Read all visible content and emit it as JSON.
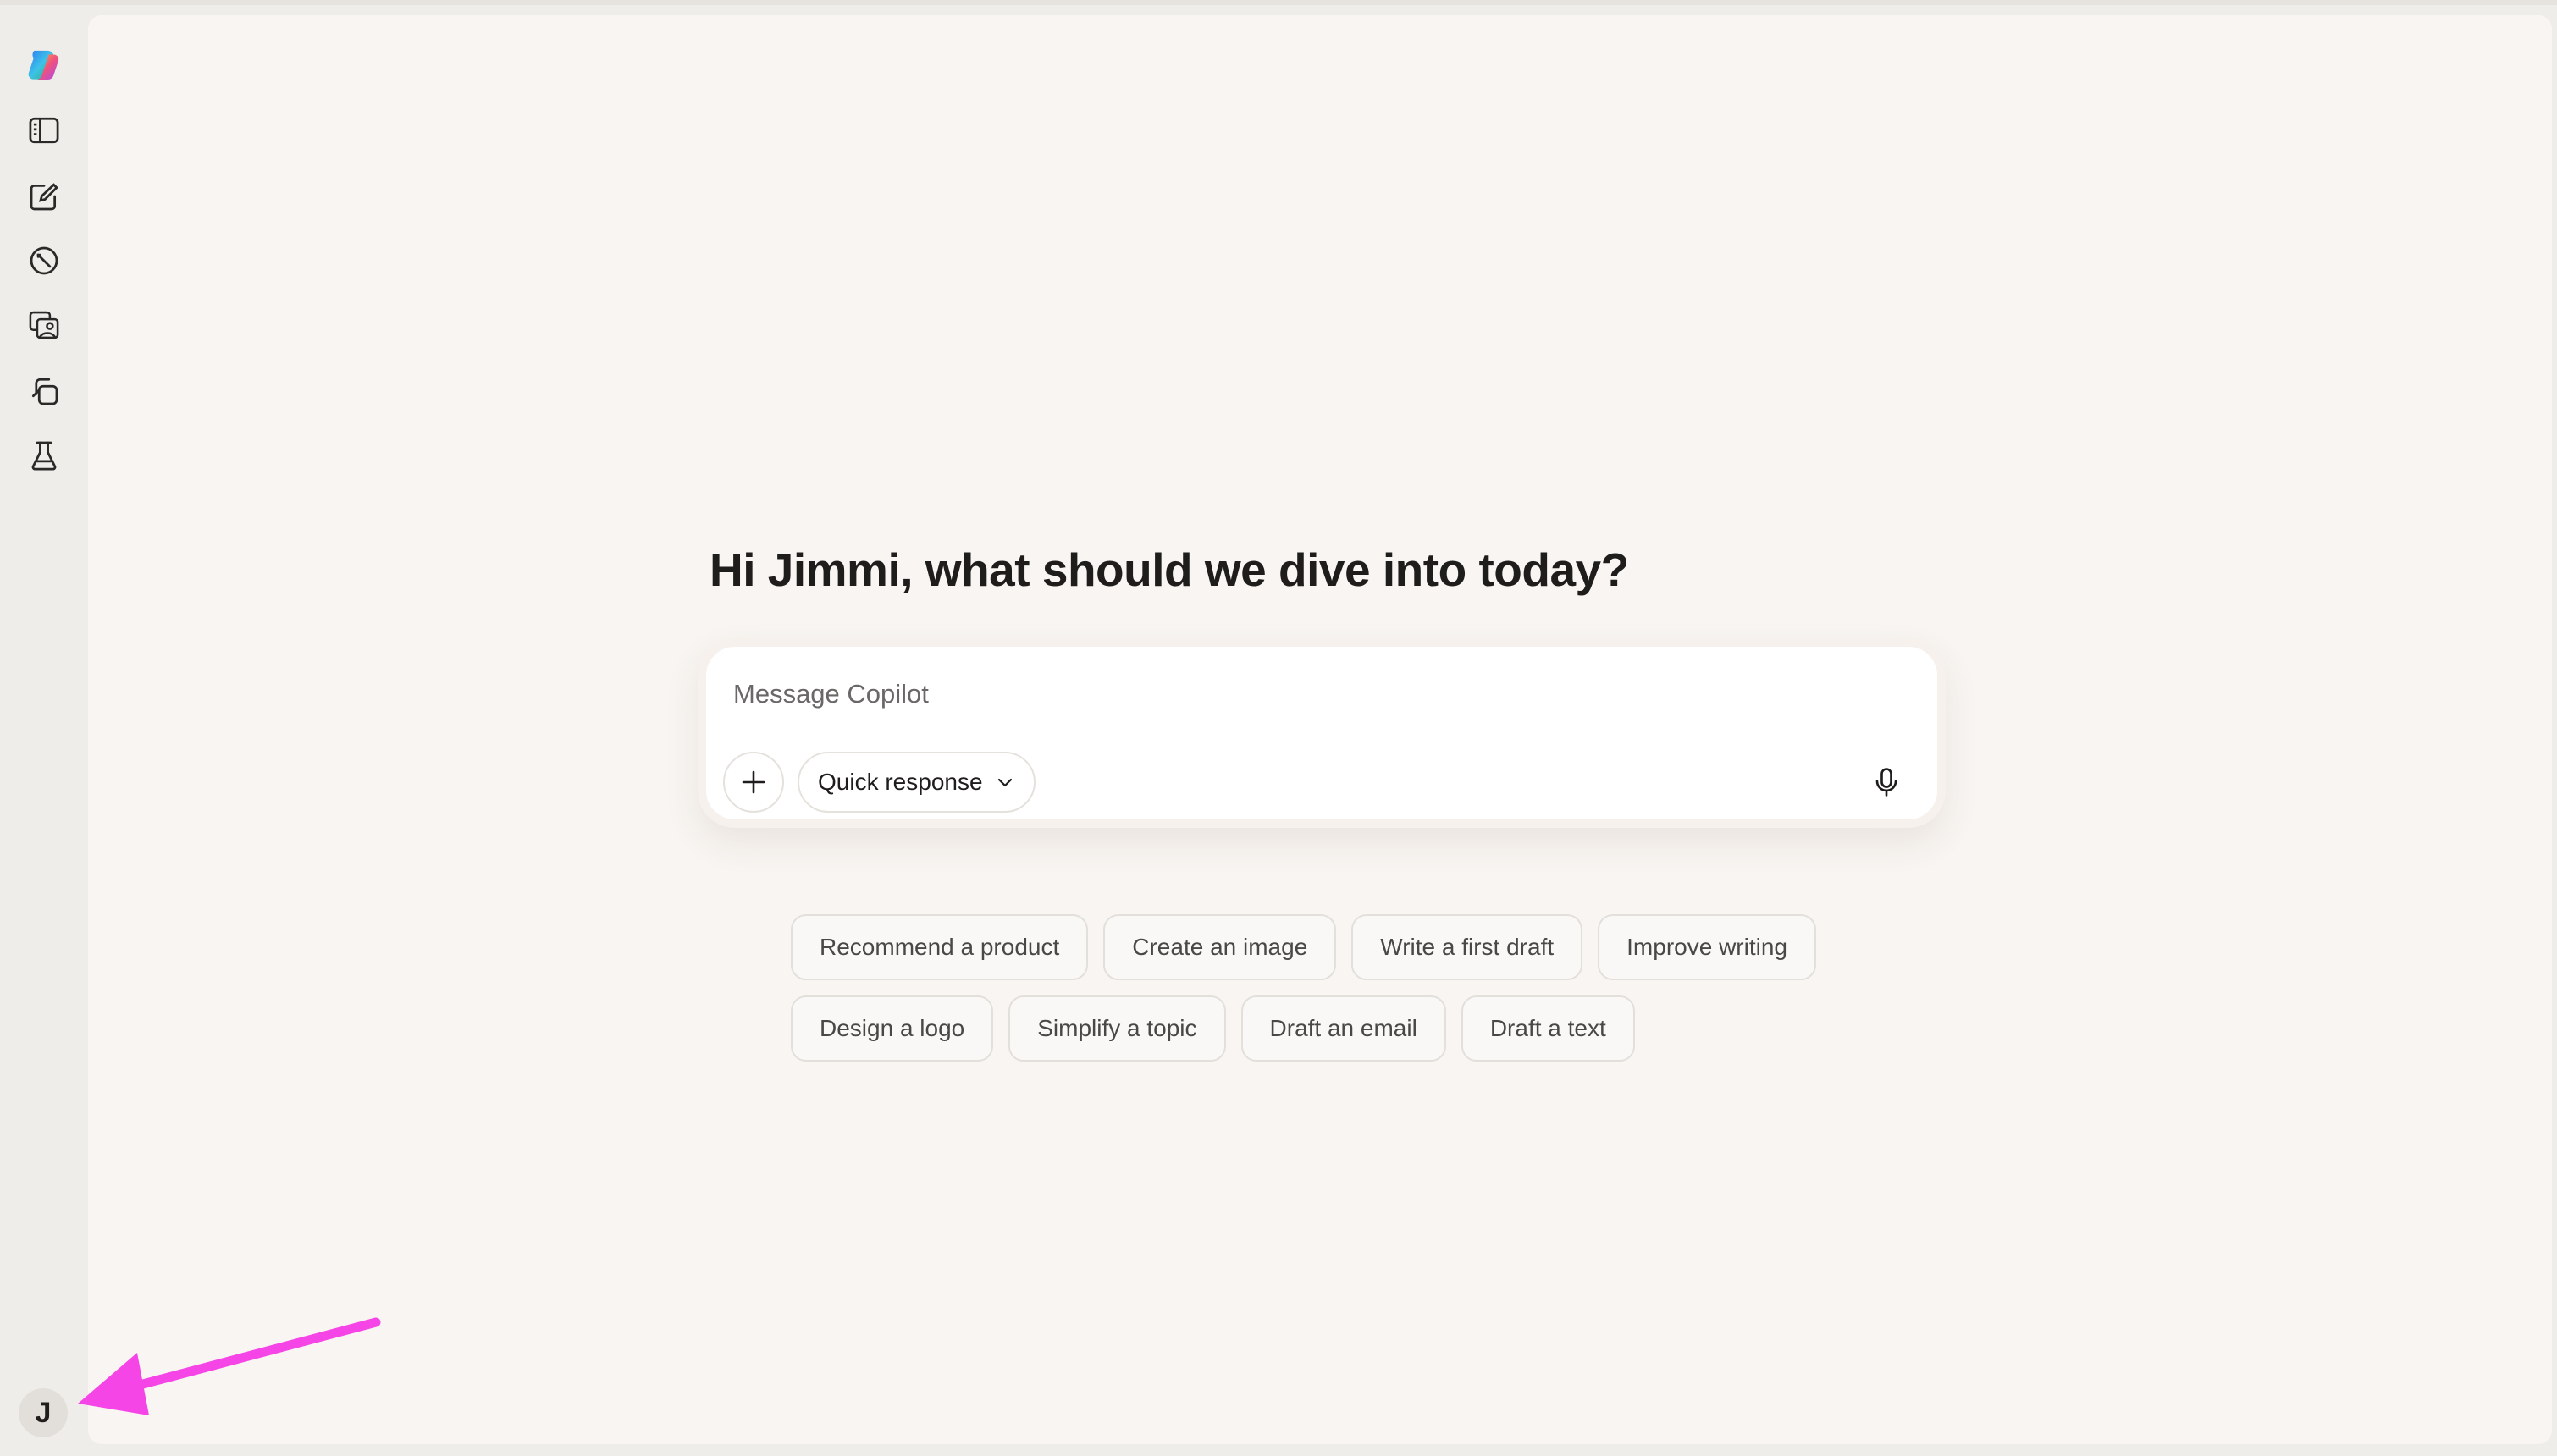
{
  "sidebar": {
    "logo_icon": "copilot-logo-icon",
    "items": [
      {
        "icon": "sidebar-toggle-icon"
      },
      {
        "icon": "new-chat-icon"
      },
      {
        "icon": "discover-compass-icon"
      },
      {
        "icon": "image-gallery-icon"
      },
      {
        "icon": "pages-icon"
      },
      {
        "icon": "labs-flask-icon"
      }
    ],
    "avatar_initial": "J"
  },
  "main": {
    "greeting": "Hi Jimmi, what should we dive into today?",
    "composer": {
      "placeholder": "Message Copilot",
      "mode_label": "Quick response"
    },
    "suggestions_row1": [
      "Recommend a product",
      "Create an image",
      "Write a first draft",
      "Improve writing"
    ],
    "suggestions_row2": [
      "Design a logo",
      "Simplify a topic",
      "Draft an email",
      "Draft a text"
    ]
  },
  "colors": {
    "annotation_arrow": "#f545e6",
    "background": "#f8f5f2",
    "sidebar": "#efedea"
  }
}
